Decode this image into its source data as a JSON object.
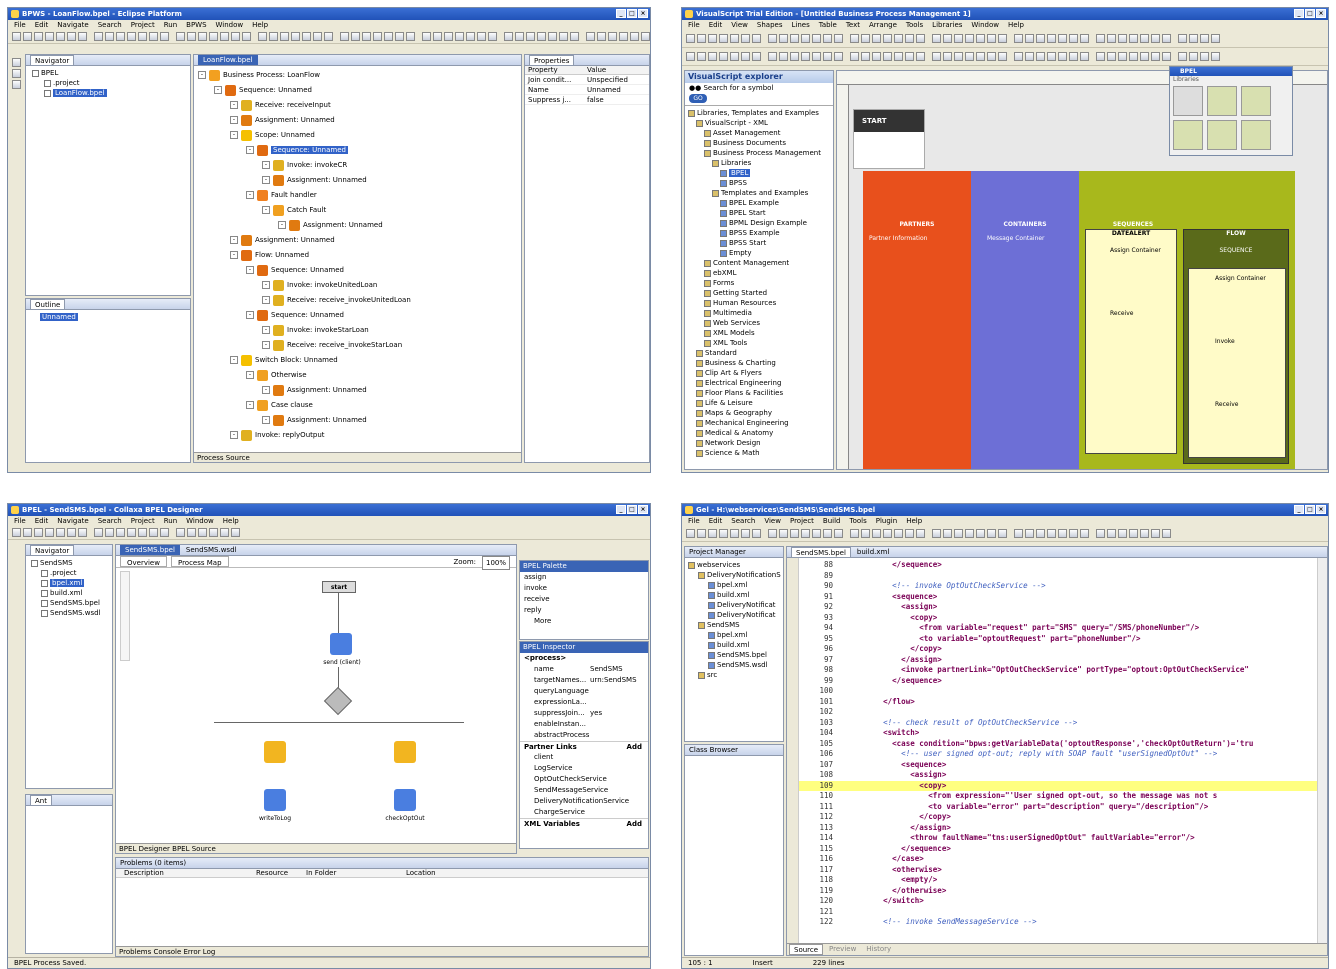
{
  "w1": {
    "title": "BPWS - LoanFlow.bpel - Eclipse Platform",
    "menu": [
      "File",
      "Edit",
      "Navigate",
      "Search",
      "Project",
      "Run",
      "BPWS",
      "Window",
      "Help"
    ],
    "navigator_tab": "Navigator",
    "nav_tree": [
      "BPEL",
      ".project",
      "LoanFlow.bpel"
    ],
    "outline_tab": "Outline",
    "outline_item": "Unnamed",
    "editor_tab": "LoanFlow.bpel",
    "tree": [
      {
        "t": "Business Process: LoanFlow",
        "d": 0,
        "c": "#f2a020"
      },
      {
        "t": "Sequence: Unnamed",
        "d": 1,
        "c": "#e06a10"
      },
      {
        "t": "Receive: receiveInput",
        "d": 2,
        "c": "#e0b020"
      },
      {
        "t": "Assignment: Unnamed",
        "d": 2,
        "c": "#e07a10"
      },
      {
        "t": "Scope: Unnamed",
        "d": 2,
        "c": "#f5c000"
      },
      {
        "t": "Sequence: Unnamed",
        "d": 3,
        "c": "#e06a10",
        "sel": true
      },
      {
        "t": "Invoke: invokeCR",
        "d": 4,
        "c": "#e0b020"
      },
      {
        "t": "Assignment: Unnamed",
        "d": 4,
        "c": "#e07a10"
      },
      {
        "t": "Fault handler",
        "d": 3,
        "c": "#f08020"
      },
      {
        "t": "Catch Fault",
        "d": 4,
        "c": "#f0a020"
      },
      {
        "t": "Assignment: Unnamed",
        "d": 5,
        "c": "#e07a10"
      },
      {
        "t": "Assignment: Unnamed",
        "d": 2,
        "c": "#e07a10"
      },
      {
        "t": "Flow: Unnamed",
        "d": 2,
        "c": "#e06a10"
      },
      {
        "t": "Sequence: Unnamed",
        "d": 3,
        "c": "#e06a10"
      },
      {
        "t": "Invoke: invokeUnitedLoan",
        "d": 4,
        "c": "#e0b020"
      },
      {
        "t": "Receive: receive_invokeUnitedLoan",
        "d": 4,
        "c": "#e0b020"
      },
      {
        "t": "Sequence: Unnamed",
        "d": 3,
        "c": "#e06a10"
      },
      {
        "t": "Invoke: invokeStarLoan",
        "d": 4,
        "c": "#e0b020"
      },
      {
        "t": "Receive: receive_invokeStarLoan",
        "d": 4,
        "c": "#e0b020"
      },
      {
        "t": "Switch Block: Unnamed",
        "d": 2,
        "c": "#f5c000"
      },
      {
        "t": "Otherwise",
        "d": 3,
        "c": "#f0a020"
      },
      {
        "t": "Assignment: Unnamed",
        "d": 4,
        "c": "#e07a10"
      },
      {
        "t": "Case clause",
        "d": 3,
        "c": "#f0a020"
      },
      {
        "t": "Assignment: Unnamed",
        "d": 4,
        "c": "#e07a10"
      },
      {
        "t": "Invoke: replyOutput",
        "d": 2,
        "c": "#e0b020"
      }
    ],
    "editor_bottom_tabs": "Process  Source",
    "props_tab": "Properties",
    "props_head": [
      "Property",
      "Value"
    ],
    "props": [
      [
        "Join condit...",
        "Unspecified"
      ],
      [
        "Name",
        "Unnamed"
      ],
      [
        "Suppress j...",
        "false"
      ]
    ]
  },
  "w2": {
    "title": "VisualScript Trial Edition - [Untitled Business Process Management 1]",
    "menu": [
      "File",
      "Edit",
      "View",
      "Shapes",
      "Lines",
      "Table",
      "Text",
      "Arrange",
      "Tools",
      "Libraries",
      "Window",
      "Help"
    ],
    "explorer_title": "VisualScript explorer",
    "search_label": "Search for a symbol",
    "go": "GO",
    "tree": [
      {
        "t": "Libraries, Templates and Examples",
        "d": 0
      },
      {
        "t": "VisualScript - XML",
        "d": 1
      },
      {
        "t": "Asset Management",
        "d": 2
      },
      {
        "t": "Business Documents",
        "d": 2
      },
      {
        "t": "Business Process Management",
        "d": 2
      },
      {
        "t": "Libraries",
        "d": 3
      },
      {
        "t": "BPEL",
        "d": 4,
        "sel": true
      },
      {
        "t": "BPSS",
        "d": 4
      },
      {
        "t": "Templates and Examples",
        "d": 3
      },
      {
        "t": "BPEL Example",
        "d": 4
      },
      {
        "t": "BPEL Start",
        "d": 4
      },
      {
        "t": "BPML Design Example",
        "d": 4
      },
      {
        "t": "BPSS Example",
        "d": 4
      },
      {
        "t": "BPSS Start",
        "d": 4
      },
      {
        "t": "Empty",
        "d": 4
      },
      {
        "t": "Content Management",
        "d": 2
      },
      {
        "t": "ebXML",
        "d": 2
      },
      {
        "t": "Forms",
        "d": 2
      },
      {
        "t": "Getting Started",
        "d": 2
      },
      {
        "t": "Human Resources",
        "d": 2
      },
      {
        "t": "Multimedia",
        "d": 2
      },
      {
        "t": "Web Services",
        "d": 2
      },
      {
        "t": "XML Models",
        "d": 2
      },
      {
        "t": "XML Tools",
        "d": 2
      },
      {
        "t": "Standard",
        "d": 1
      },
      {
        "t": "Business & Charting",
        "d": 1
      },
      {
        "t": "Clip Art & Flyers",
        "d": 1
      },
      {
        "t": "Electrical Engineering",
        "d": 1
      },
      {
        "t": "Floor Plans & Facilities",
        "d": 1
      },
      {
        "t": "Life & Leisure",
        "d": 1
      },
      {
        "t": "Maps & Geography",
        "d": 1
      },
      {
        "t": "Mechanical Engineering",
        "d": 1
      },
      {
        "t": "Medical & Anatomy",
        "d": 1
      },
      {
        "t": "Network Design",
        "d": 1
      },
      {
        "t": "Science & Math",
        "d": 1
      }
    ],
    "start": "START",
    "lanes": [
      "PARTNERS",
      "CONTAINERS",
      "SEQUENCES"
    ],
    "seq_head": "DATEALERT",
    "flow_head": "FLOW",
    "flow_sub": "SEQUENCE",
    "assign": "Assign Container",
    "receive": "Receive",
    "invoke": "Invoke",
    "partner_info": "Partner Information",
    "message_container": "Message Container",
    "palette_title": "BPEL",
    "palette_sub": "Libraries"
  },
  "w3": {
    "title": "BPEL - SendSMS.bpel - Collaxa BPEL Designer",
    "menu": [
      "File",
      "Edit",
      "Navigate",
      "Search",
      "Project",
      "Run",
      "Window",
      "Help"
    ],
    "navigator_tab": "Navigator",
    "nav_tree": [
      "SendSMS",
      ".project",
      "bpel.xml",
      "build.xml",
      "SendSMS.bpel",
      "SendSMS.wsdl"
    ],
    "editor_tabs": [
      "SendSMS.bpel",
      "SendSMS.wsdl"
    ],
    "subtabs": [
      "Overview",
      "Process Map"
    ],
    "zoom_label": "Zoom:",
    "zoom": "100%",
    "start": "start",
    "send_client": "send (client)",
    "write_to_log": "writeToLog",
    "check_opt_out": "checkOptOut",
    "assign": "assign",
    "invoke": "invoke",
    "palette_title": "BPEL Palette",
    "palette": [
      "assign",
      "invoke",
      "receive",
      "reply"
    ],
    "more": "More",
    "inspector_title": "BPEL Inspector",
    "process_tag": "<process>",
    "props": [
      [
        "name",
        "SendSMS"
      ],
      [
        "targetNames...",
        "urn:SendSMS"
      ],
      [
        "queryLanguage",
        ""
      ],
      [
        "expressionLa...",
        ""
      ],
      [
        "suppressJoin...",
        "yes"
      ],
      [
        "enableInstan...",
        ""
      ],
      [
        "abstractProcess",
        ""
      ]
    ],
    "partner_links": "Partner Links",
    "add": "Add",
    "links": [
      "client",
      "LogService",
      "OptOutCheckService",
      "SendMessageService",
      "DeliveryNotificationService",
      "ChargeService"
    ],
    "xml_vars": "XML Variables",
    "editor_bottom_tabs": "BPEL Designer  BPEL Source",
    "ant_tab": "Ant",
    "problems_title": "Problems (0 items)",
    "problems_cols": [
      "Description",
      "Resource",
      "In Folder",
      "Location"
    ],
    "bottom_tabs": "Problems  Console  Error Log",
    "status": "BPEL Process Saved."
  },
  "w4": {
    "title": "Gel - H:\\webservices\\SendSMS\\SendSMS.bpel",
    "menu": [
      "File",
      "Edit",
      "Search",
      "View",
      "Project",
      "Build",
      "Tools",
      "Plugin",
      "Help"
    ],
    "project_manager": "Project Manager",
    "pm_tree": [
      {
        "t": "webservices",
        "d": 0
      },
      {
        "t": "DeliveryNotificationS",
        "d": 1
      },
      {
        "t": "bpel.xml",
        "d": 2
      },
      {
        "t": "build.xml",
        "d": 2
      },
      {
        "t": "DeliveryNotificat",
        "d": 2
      },
      {
        "t": "DeliveryNotificat",
        "d": 2
      },
      {
        "t": "SendSMS",
        "d": 1
      },
      {
        "t": "bpel.xml",
        "d": 2
      },
      {
        "t": "build.xml",
        "d": 2
      },
      {
        "t": "SendSMS.bpel",
        "d": 2
      },
      {
        "t": "SendSMS.wsdl",
        "d": 2
      },
      {
        "t": "src",
        "d": 1
      }
    ],
    "class_browser": "Class Browser",
    "tabs": [
      "SendSMS.bpel",
      "build.xml"
    ],
    "code": [
      [
        "88",
        "          </sequence>"
      ],
      [
        "89",
        ""
      ],
      [
        "90",
        "          <!-- invoke OptOutCheckService -->"
      ],
      [
        "91",
        "          <sequence>"
      ],
      [
        "92",
        "            <assign>"
      ],
      [
        "93",
        "              <copy>"
      ],
      [
        "94",
        "                <from variable=\"request\" part=\"SMS\" query=\"/SMS/phoneNumber\"/>"
      ],
      [
        "95",
        "                <to variable=\"optoutRequest\" part=\"phoneNumber\"/>"
      ],
      [
        "96",
        "              </copy>"
      ],
      [
        "97",
        "            </assign>"
      ],
      [
        "98",
        "            <invoke partnerLink=\"OptOutCheckService\" portType=\"optout:OptOutCheckService\""
      ],
      [
        "99",
        "          </sequence>"
      ],
      [
        "100",
        ""
      ],
      [
        "101",
        "        </flow>"
      ],
      [
        "102",
        ""
      ],
      [
        "103",
        "        <!-- check result of OptOutCheckService -->"
      ],
      [
        "104",
        "        <switch>"
      ],
      [
        "105",
        "          <case condition=\"bpws:getVariableData('optoutResponse','checkOptOutReturn')='tru"
      ],
      [
        "106",
        "            <!-- user signed opt-out; reply with SOAP fault \"userSignedOptOut\" -->"
      ],
      [
        "107",
        "            <sequence>"
      ],
      [
        "108",
        "              <assign>"
      ],
      [
        "109",
        "                <copy>"
      ],
      [
        "110",
        "                  <from expression=\"'User signed opt-out, so the message was not s"
      ],
      [
        "111",
        "                  <to variable=\"error\" part=\"description\" query=\"/description\"/>"
      ],
      [
        "112",
        "                </copy>"
      ],
      [
        "113",
        "              </assign>"
      ],
      [
        "114",
        "              <throw faultName=\"tns:userSignedOptOut\" faultVariable=\"error\"/>"
      ],
      [
        "115",
        "            </sequence>"
      ],
      [
        "116",
        "          </case>"
      ],
      [
        "117",
        "          <otherwise>"
      ],
      [
        "118",
        "            <empty/>"
      ],
      [
        "119",
        "          </otherwise>"
      ],
      [
        "120",
        "        </switch>"
      ],
      [
        "121",
        ""
      ],
      [
        "122",
        "        <!-- invoke SendMessageService -->"
      ]
    ],
    "bottom_tabs": [
      "Source",
      "Preview",
      "History"
    ],
    "status": [
      "105 : 1",
      "Insert",
      "229 lines"
    ]
  }
}
